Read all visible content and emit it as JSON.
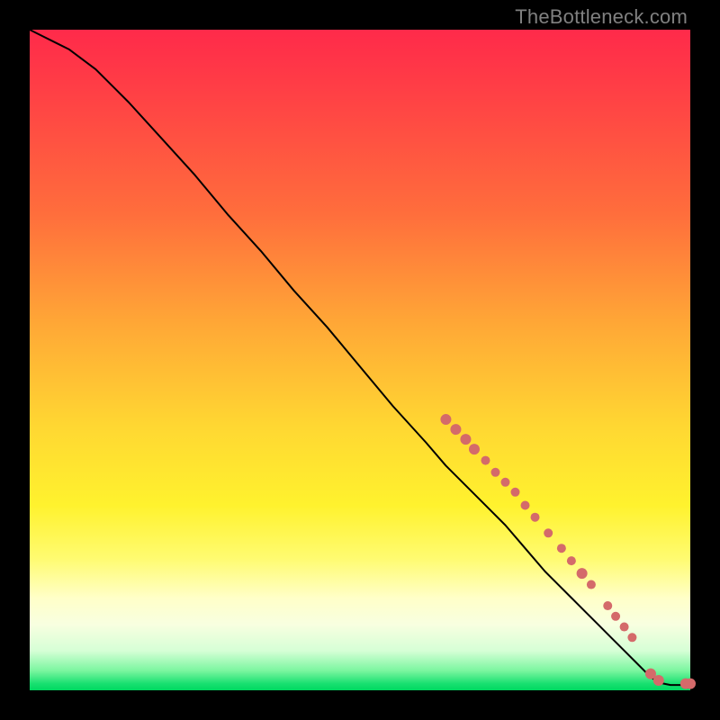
{
  "watermark": "TheBottleneck.com",
  "colors": {
    "curve_stroke": "#000000",
    "marker_fill": "#d46a6a",
    "marker_stroke": "#d46a6a"
  },
  "chart_data": {
    "type": "line",
    "title": "",
    "xlabel": "",
    "ylabel": "",
    "xlim": [
      0,
      100
    ],
    "ylim": [
      0,
      100
    ],
    "series": [
      {
        "name": "curve",
        "x": [
          0,
          2,
          4,
          6,
          8,
          10,
          15,
          20,
          25,
          30,
          35,
          40,
          45,
          50,
          55,
          60,
          63,
          66,
          69,
          72,
          75,
          78,
          80,
          82,
          84,
          86,
          88,
          90,
          92,
          94,
          95,
          96,
          97,
          100
        ],
        "y": [
          100,
          99,
          98,
          97,
          95.5,
          94,
          89,
          83.5,
          78,
          72,
          66.5,
          60.5,
          55,
          49,
          43,
          37.5,
          34,
          31,
          28,
          25,
          21.5,
          18,
          16,
          14,
          12,
          10,
          8,
          6,
          4,
          2,
          1.3,
          1,
          0.8,
          0.8
        ]
      }
    ],
    "markers": [
      {
        "x": 63.0,
        "y": 41.0,
        "r": 6
      },
      {
        "x": 64.5,
        "y": 39.5,
        "r": 6
      },
      {
        "x": 66.0,
        "y": 38.0,
        "r": 6
      },
      {
        "x": 67.3,
        "y": 36.5,
        "r": 6
      },
      {
        "x": 69.0,
        "y": 34.8,
        "r": 5
      },
      {
        "x": 70.5,
        "y": 33.0,
        "r": 5
      },
      {
        "x": 72.0,
        "y": 31.5,
        "r": 5
      },
      {
        "x": 73.5,
        "y": 30.0,
        "r": 5
      },
      {
        "x": 75.0,
        "y": 28.0,
        "r": 5
      },
      {
        "x": 76.5,
        "y": 26.2,
        "r": 5
      },
      {
        "x": 78.5,
        "y": 23.8,
        "r": 5
      },
      {
        "x": 80.5,
        "y": 21.5,
        "r": 5
      },
      {
        "x": 82.0,
        "y": 19.6,
        "r": 5
      },
      {
        "x": 83.6,
        "y": 17.7,
        "r": 6
      },
      {
        "x": 85.0,
        "y": 16.0,
        "r": 5
      },
      {
        "x": 87.5,
        "y": 12.8,
        "r": 5
      },
      {
        "x": 88.7,
        "y": 11.2,
        "r": 5
      },
      {
        "x": 90.0,
        "y": 9.6,
        "r": 5
      },
      {
        "x": 91.2,
        "y": 8.0,
        "r": 5
      },
      {
        "x": 94.0,
        "y": 2.5,
        "r": 6
      },
      {
        "x": 95.2,
        "y": 1.5,
        "r": 6
      },
      {
        "x": 99.3,
        "y": 1.0,
        "r": 6
      },
      {
        "x": 100.0,
        "y": 1.0,
        "r": 6
      }
    ]
  }
}
